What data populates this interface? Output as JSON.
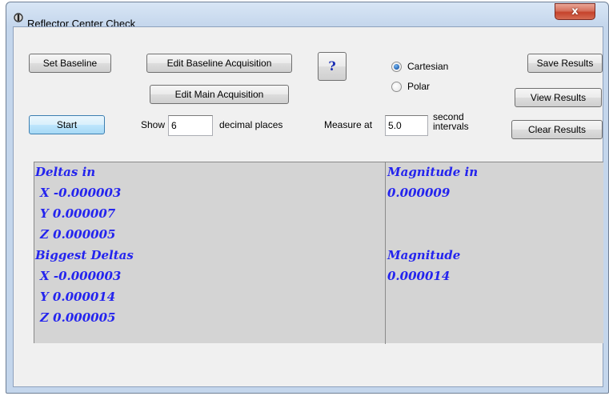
{
  "window": {
    "title": "Reflector Center Check",
    "close_label": "x"
  },
  "buttons": {
    "set_baseline": "Set Baseline",
    "edit_baseline_acquisition": "Edit Baseline Acquisition",
    "edit_main_acquisition": "Edit Main Acquisition",
    "help": "?",
    "save_results": "Save Results",
    "view_results": "View Results",
    "clear_results": "Clear Results",
    "start": "Start"
  },
  "coordinates": {
    "selected": "Cartesian",
    "options": [
      "Cartesian",
      "Polar"
    ]
  },
  "decimal_places": {
    "prefix": "Show",
    "value": "6",
    "suffix": "decimal places"
  },
  "measure": {
    "prefix": "Measure at",
    "value": "5.0",
    "suffix_line1": "second",
    "suffix_line2": "intervals"
  },
  "results": {
    "deltas_heading": "Deltas in",
    "deltas": [
      "X -0.000003",
      "Y 0.000007",
      "Z 0.000005"
    ],
    "magnitude_heading": "Magnitude in",
    "magnitude": "0.000009",
    "biggest_heading": "Biggest Deltas",
    "biggest": [
      "X -0.000003",
      "Y 0.000014",
      "Z 0.000005"
    ],
    "biggest_magnitude_heading": "Magnitude",
    "biggest_magnitude": "0.000014"
  },
  "colors": {
    "results_text": "#2424ee",
    "results_background": "#d4d4d4",
    "start_button_accent": "#a7d9f5"
  }
}
